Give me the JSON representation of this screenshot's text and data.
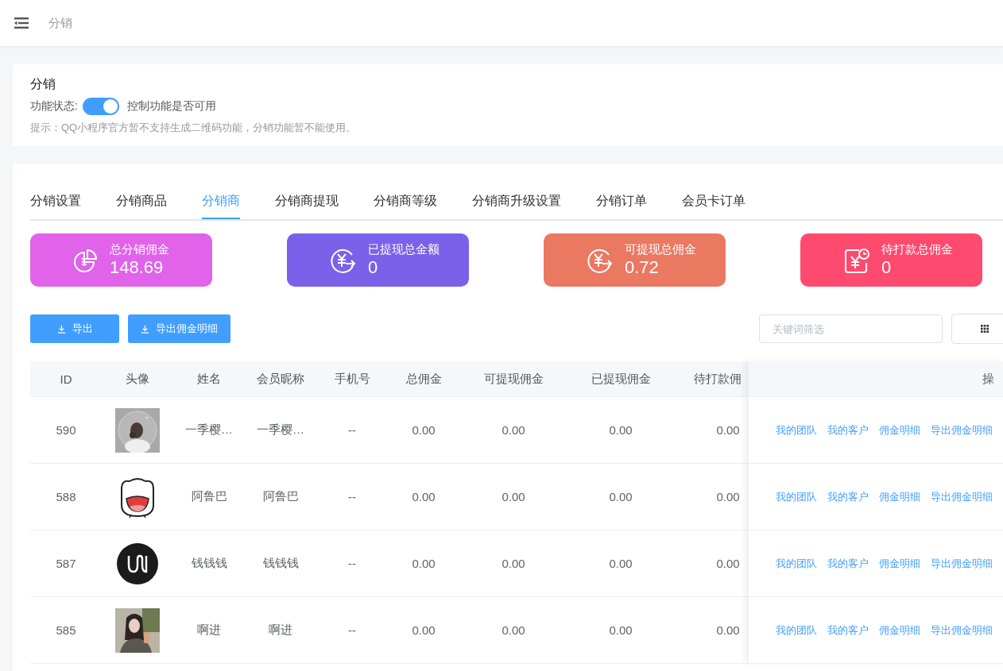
{
  "header": {
    "breadcrumb": "分销"
  },
  "settings": {
    "title": "分销",
    "status_label": "功能状态:",
    "toggle": {
      "on": true
    },
    "toggle_hint": "控制功能是否可用",
    "notice": "提示：QQ小程序官方暂不支持生成二维码功能，分销功能暂不能使用。"
  },
  "tabs": [
    {
      "label": "分销设置",
      "selected": false
    },
    {
      "label": "分销商品",
      "selected": false
    },
    {
      "label": "分销商",
      "selected": true
    },
    {
      "label": "分销商提现",
      "selected": false
    },
    {
      "label": "分销商等级",
      "selected": false
    },
    {
      "label": "分销商升级设置",
      "selected": false
    },
    {
      "label": "分销订单",
      "selected": false
    },
    {
      "label": "会员卡订单",
      "selected": false
    }
  ],
  "stats": [
    {
      "kind": "pie",
      "title": "总分销佣金",
      "value": "148.69",
      "color": "#e063ea"
    },
    {
      "kind": "yen-arrow",
      "title": "已提现总金额",
      "value": "0",
      "color": "#7b61ea"
    },
    {
      "kind": "yen-arrow",
      "title": "可提现总佣金",
      "value": "0.72",
      "color": "#eb7861"
    },
    {
      "kind": "yen-clock",
      "title": "待打款总佣金",
      "value": "0",
      "color": "#fe4a6e"
    }
  ],
  "toolbar": {
    "buttons": [
      "导出",
      "导出佣金明细"
    ],
    "search": {
      "placeholder": "关键词筛选"
    }
  },
  "table": {
    "columns": [
      "ID",
      "头像",
      "姓名",
      "会员昵称",
      "手机号",
      "总佣金",
      "可提现佣金",
      "已提现佣金",
      "待打款佣"
    ],
    "actions_column": "操",
    "rows": [
      {
        "id": "590",
        "name": "一季樱…",
        "nickname": "一季樱…",
        "phone": "--",
        "total": "0.00",
        "withdrawable": "0.00",
        "withdrawn": "0.00",
        "pending": "0.00",
        "actions": [
          "我的团队",
          "我的客户",
          "佣金明细",
          "导出佣金明细"
        ]
      },
      {
        "id": "588",
        "name": "阿鲁巴",
        "nickname": "阿鲁巴",
        "phone": "--",
        "total": "0.00",
        "withdrawable": "0.00",
        "withdrawn": "0.00",
        "pending": "0.00",
        "actions": [
          "我的团队",
          "我的客户",
          "佣金明细",
          "导出佣金明细"
        ]
      },
      {
        "id": "587",
        "name": "钱钱钱",
        "nickname": "钱钱钱",
        "phone": "--",
        "total": "0.00",
        "withdrawable": "0.00",
        "withdrawn": "0.00",
        "pending": "0.00",
        "actions": [
          "我的团队",
          "我的客户",
          "佣金明细",
          "导出佣金明细"
        ]
      },
      {
        "id": "585",
        "name": "啊进",
        "nickname": "啊进",
        "phone": "--",
        "total": "0.00",
        "withdrawable": "0.00",
        "withdrawn": "0.00",
        "pending": "0.00",
        "actions": [
          "我的团队",
          "我的客户",
          "佣金明细",
          "导出佣金明细"
        ]
      }
    ]
  }
}
